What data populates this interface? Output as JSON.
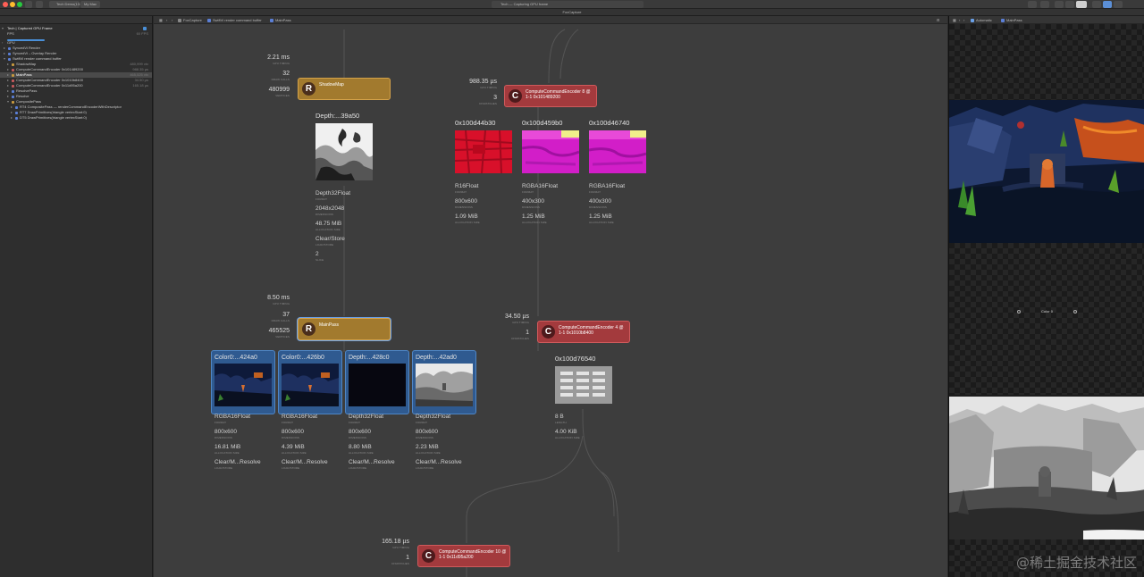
{
  "window": {
    "title_tab_1": "Tech Demo(13:...",
    "title_tab_2": "My Mac",
    "status_text": "Tech — Capturing GPU frame",
    "document_title": "FoxCapture"
  },
  "sidebar": {
    "header": "Tech | Captured GPU Frame",
    "rows": [
      {
        "label": "FPS",
        "meta": "60 FPS"
      },
      {
        "label": "GPU",
        "meta": ""
      },
      {
        "label": "SyncedVi Render",
        "meta": ""
      },
      {
        "label": "SyncedVi – Overlay Render",
        "meta": ""
      },
      {
        "label": "SwiftVi render command buffer",
        "meta": ""
      },
      {
        "label": "ShadowMap",
        "meta": "480,999 vtx"
      },
      {
        "label": "ComputeCommandEncoder 0x101489200",
        "meta": "988.35 µs"
      },
      {
        "label": "MainPass",
        "meta": "465,525 vtx"
      },
      {
        "label": "ComputeCommandEncoder 0x1010b8400",
        "meta": "34.50 µs"
      },
      {
        "label": "ComputeCommandEncoder 0x11d95a200",
        "meta": "165.18 µs"
      },
      {
        "label": "ResolvePass",
        "meta": ""
      },
      {
        "label": "Resolve",
        "meta": ""
      },
      {
        "label": "CompositePass",
        "meta": ""
      },
      {
        "label": "RT4 CompositePass — renderCommandEncoderWithDescriptor",
        "meta": ""
      },
      {
        "label": "RT7 DrawPrimitives(triangle vertexStart:0)",
        "meta": ""
      },
      {
        "label": "DT5 DrawPrimitives(triangle vertexStart:0)",
        "meta": ""
      }
    ]
  },
  "breadcrumb": {
    "item1": "FoxCapture",
    "item2": "SwiftVi render command buffer",
    "item3": "MainPass"
  },
  "graph": {
    "shadow": {
      "gpu_time": "2.21 ms",
      "gpu_time_key": "GPU TIMING",
      "draw_calls": "32",
      "draw_calls_key": "DRAW CALLS",
      "vertices": "480999",
      "vertices_key": "VERTICES",
      "badge": "R",
      "name": "ShadowMap"
    },
    "depth_tex": {
      "name": "Depth:...39a50",
      "format": "Depth32Float",
      "format_key": "FORMAT",
      "dims": "2048x2048",
      "dims_key": "DIMENSIONS",
      "alloc": "48.75 MiB",
      "alloc_key": "ALLOCATION SIZE",
      "load": "Clear/Store",
      "load_key": "LOAD/STORE",
      "slice": "2",
      "slice_key": "SLICE"
    },
    "compute1": {
      "gpu_time": "988.35 µs",
      "gpu_time_key": "GPU TIMING",
      "dispatches": "3",
      "dispatches_key": "DISPATCHES",
      "badge": "C",
      "name": "ComputeCommandEncoder 8 @ 1-1 0x101489200"
    },
    "compute_tex": [
      {
        "name": "0x100d44b30",
        "format": "R16Float",
        "format_key": "FORMAT",
        "dims": "800x600",
        "dims_key": "DIMENSIONS",
        "alloc": "1.09 MiB",
        "alloc_key": "ALLOCATION SIZE"
      },
      {
        "name": "0x100d459b0",
        "format": "RGBA16Float",
        "format_key": "FORMAT",
        "dims": "400x300",
        "dims_key": "DIMENSIONS",
        "alloc": "1.25 MiB",
        "alloc_key": "ALLOCATION SIZE"
      },
      {
        "name": "0x100d46740",
        "format": "RGBA16Float",
        "format_key": "FORMAT",
        "dims": "400x300",
        "dims_key": "DIMENSIONS",
        "alloc": "1.25 MiB",
        "alloc_key": "ALLOCATION SIZE"
      }
    ],
    "main": {
      "gpu_time": "8.50 ms",
      "gpu_time_key": "GPU TIMING",
      "draw_calls": "37",
      "draw_calls_key": "DRAW CALLS",
      "vertices": "465525",
      "vertices_key": "VERTICES",
      "badge": "R",
      "name": "MainPass"
    },
    "main_att": [
      {
        "name": "Color0:...424a0",
        "format": "RGBA16Float",
        "format_key": "FORMAT",
        "dims": "800x600",
        "dims_key": "DIMENSIONS",
        "alloc": "16.81 MiB",
        "alloc_key": "ALLOCATION SIZE",
        "load": "Clear/M...Resolve",
        "load_key": "LOAD/STORE"
      },
      {
        "name": "Color0:...426b0",
        "format": "RGBA16Float",
        "format_key": "FORMAT",
        "dims": "800x600",
        "dims_key": "DIMENSIONS",
        "alloc": "4.39 MiB",
        "alloc_key": "ALLOCATION SIZE",
        "load": "Clear/M...Resolve",
        "load_key": "LOAD/STORE"
      },
      {
        "name": "Depth:...428c0",
        "format": "Depth32Float",
        "format_key": "FORMAT",
        "dims": "800x600",
        "dims_key": "DIMENSIONS",
        "alloc": "8.80 MiB",
        "alloc_key": "ALLOCATION SIZE",
        "load": "Clear/M...Resolve",
        "load_key": "LOAD/STORE"
      },
      {
        "name": "Depth:...42ad0",
        "format": "Depth32Float",
        "format_key": "FORMAT",
        "dims": "800x600",
        "dims_key": "DIMENSIONS",
        "alloc": "2.23 MiB",
        "alloc_key": "ALLOCATION SIZE",
        "load": "Clear/M...Resolve",
        "load_key": "LOAD/STORE"
      }
    ],
    "compute2": {
      "gpu_time": "34.50 µs",
      "gpu_time_key": "GPU TIMING",
      "dispatches": "1",
      "dispatches_key": "DISPATCHES",
      "badge": "C",
      "name": "ComputeCommandEncoder 4 @ 1-1 0x1010b8400"
    },
    "buffer": {
      "name": "0x100d76540",
      "length": "8 B",
      "length_key": "LENGTH",
      "alloc": "4.00 KiB",
      "alloc_key": "ALLOCATION SIZE"
    },
    "compute3": {
      "gpu_time": "165.18 µs",
      "gpu_time_key": "GPU TIMING",
      "dispatches": "1",
      "dispatches_key": "DISPATCHES",
      "badge": "C",
      "name": "ComputeCommandEncoder 10 @ 1-1 0x11d95a200"
    }
  },
  "preview": {
    "toolbar_item1": "Automatic",
    "toolbar_item2": "MainPass",
    "color_label": "Color 0",
    "watermark": "@稀土掘金技术社区"
  },
  "colors": {
    "render_pass": "#a27a2e",
    "compute_pass": "#a33a3d",
    "attachment_selected": "#2f5a90",
    "graph_bg": "#3d3d3d"
  }
}
